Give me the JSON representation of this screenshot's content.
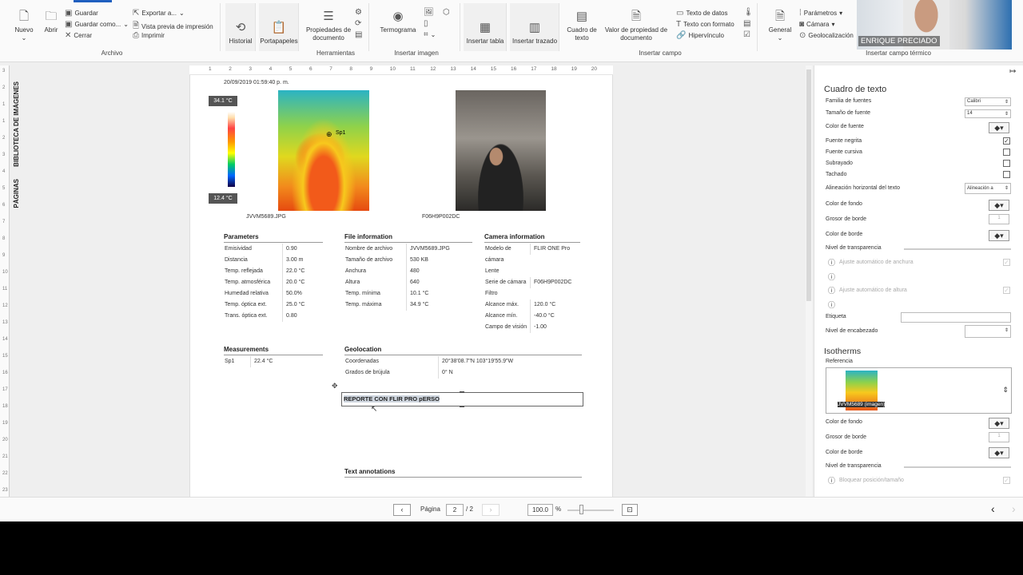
{
  "ribbon": {
    "archivo": {
      "label": "Archivo",
      "nuevo": "Nuevo",
      "abrir": "Abrir",
      "guardar": "Guardar",
      "guardar_como": "Guardar como...",
      "cerrar": "Cerrar",
      "exportar": "Exportar a...",
      "vista_previa": "Vista previa de impresión",
      "imprimir": "Imprimir"
    },
    "historial": "Historial",
    "portapapeles": "Portapapeles",
    "herramientas": {
      "label": "Herramientas",
      "propiedades": "Propiedades de documento"
    },
    "insertar_imagen": {
      "label": "Insertar imagen",
      "termograma": "Termograma"
    },
    "insertar_tabla": "Insertar tabla",
    "insertar_trazado": "Insertar trazado",
    "insertar_campo": {
      "label": "Insertar campo",
      "cuadro": "Cuadro de texto",
      "valor": "Valor de propiedad de documento",
      "datos": "Texto de datos",
      "formato": "Texto con formato",
      "hipervinculo": "Hipervínculo"
    },
    "campo_termico": {
      "label": "Insertar campo térmico",
      "general": "General",
      "parametros": "Parámetros",
      "camara": "Cámara",
      "geolocalizacion": "Geolocalización"
    }
  },
  "webcam": {
    "name": "ENRIQUE PRECIADO"
  },
  "side_tabs": {
    "biblioteca": "BIBLIOTECA DE IMÁGENES",
    "paginas": "PÁGINAS"
  },
  "ruler": {
    "h": [
      "1",
      "2",
      "3",
      "4",
      "5",
      "6",
      "7",
      "8",
      "9",
      "10",
      "11",
      "12",
      "13",
      "14",
      "15",
      "16",
      "17",
      "18",
      "19",
      "20"
    ],
    "v": [
      "3",
      "2",
      "1",
      "1",
      "2",
      "3",
      "4",
      "5",
      "6",
      "7",
      "8",
      "9",
      "10",
      "11",
      "12",
      "13",
      "14",
      "15",
      "16",
      "17",
      "18",
      "19",
      "20",
      "21",
      "22",
      "23"
    ]
  },
  "report": {
    "datetime": "20/09/2019 01:59:40 p. m.",
    "scale_max": "34.1 °C",
    "scale_min": "12.4 °C",
    "spot_label": "Sp1",
    "ir_caption": "JVVM5689.JPG",
    "photo_caption": "F06H9P002DC",
    "parameters": {
      "title": "Parameters",
      "rows": [
        [
          "Emisividad",
          "0.90"
        ],
        [
          "Distancia",
          "3.00 m"
        ],
        [
          "Temp. reflejada",
          "22.0 °C"
        ],
        [
          "Temp. atmosférica",
          "20.0 °C"
        ],
        [
          "Humedad relativa",
          "50.0%"
        ],
        [
          "Temp. óptica ext.",
          "25.0 °C"
        ],
        [
          "Trans. óptica ext.",
          "0.80"
        ]
      ]
    },
    "file_info": {
      "title": "File information",
      "rows": [
        [
          "Nombre de archivo",
          "JVVM5689.JPG"
        ],
        [
          "Tamaño de archivo",
          "530 KB"
        ],
        [
          "Anchura",
          "480"
        ],
        [
          "Altura",
          "640"
        ],
        [
          "Temp. mínima",
          "10.1 °C"
        ],
        [
          "Temp. máxima",
          "34.9 °C"
        ]
      ]
    },
    "camera_info": {
      "title": "Camera information",
      "rows": [
        [
          "Modelo de",
          "FLIR ONE Pro"
        ],
        [
          "cámara",
          ""
        ],
        [
          "Lente",
          ""
        ],
        [
          "Serie de cámara",
          "F06H9P002DC"
        ],
        [
          "Filtro",
          ""
        ],
        [
          "Alcance máx.",
          "120.0 °C"
        ],
        [
          "Alcance mín.",
          "-40.0 °C"
        ],
        [
          "Campo de visión",
          "-1.00"
        ]
      ]
    },
    "measurements": {
      "title": "Measurements",
      "rows": [
        [
          "Sp1",
          "22.4 °C"
        ]
      ]
    },
    "geolocation": {
      "title": "Geolocation",
      "rows": [
        [
          "Coordenadas",
          "20°38'08.7\"N 103°19'55.9\"W"
        ],
        [
          "Grados de brújula",
          "0° N"
        ]
      ]
    },
    "textbox_value": "REPORTE CON FLIR PRO pERSO",
    "text_annotations": "Text annotations"
  },
  "panel": {
    "title": "Cuadro de texto",
    "familia_label": "Familia de fuentes",
    "familia_value": "Calibri",
    "tamano_label": "Tamaño de fuente",
    "tamano_value": "14",
    "color_fuente": "Color de fuente",
    "negrita": "Fuente negrita",
    "cursiva": "Fuente cursiva",
    "subrayado": "Subrayado",
    "tachado": "Tachado",
    "alineacion_label": "Alineación horizontal del texto",
    "alineacion_value": "Alineación a",
    "color_fondo": "Color de fondo",
    "grosor": "Grosor de borde",
    "grosor_value": "1",
    "color_borde": "Color de borde",
    "transparencia": "Nivel de transparencia",
    "ajuste_anchura": "Ajuste automático de anchura",
    "ajuste_altura": "Ajuste automático de altura",
    "etiqueta": "Etiqueta",
    "encabezado": "Nivel de encabezado",
    "iso_title": "Isotherms",
    "referencia": "Referencia",
    "ref_caption": "JVVM5689 (imagen)",
    "iso_color_fondo": "Color de fondo",
    "iso_grosor": "Grosor de borde",
    "iso_grosor_value": "1",
    "iso_color_borde": "Color de borde",
    "iso_transparencia": "Nivel de transparencia",
    "bloquear": "Bloquear posición/tamaño"
  },
  "status": {
    "pagina_label": "Página",
    "page": "2",
    "total": "/ 2",
    "zoom": "100.0",
    "pct": "%"
  }
}
